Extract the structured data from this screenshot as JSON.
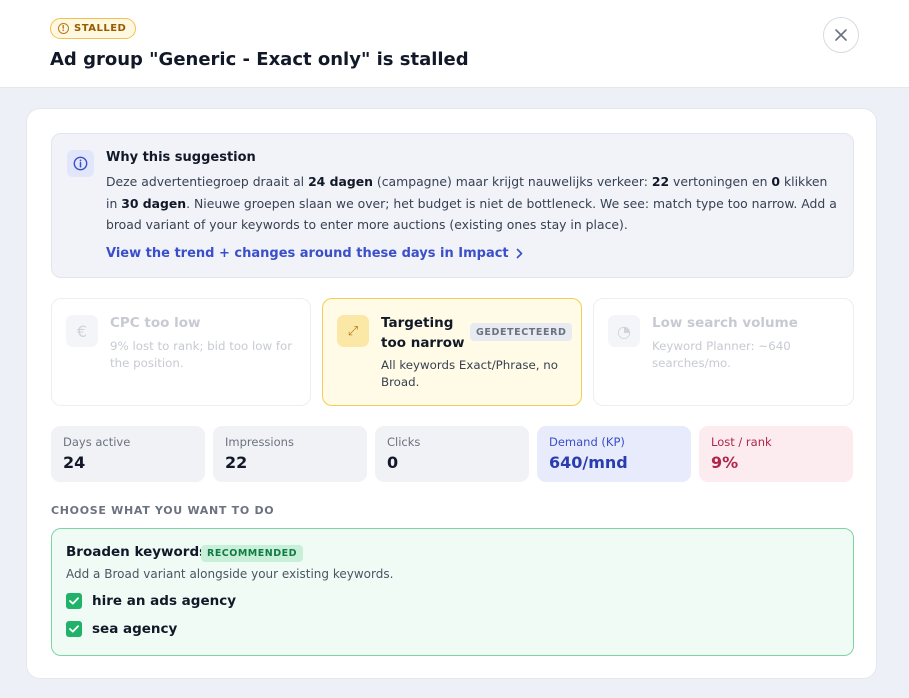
{
  "header": {
    "status_badge": "STALLED",
    "title": "Ad group \"Generic - Exact only\" is stalled"
  },
  "why": {
    "heading": "Why this suggestion",
    "t1": "Deze advertentiegroep draait al ",
    "days_campaign": "24 dagen",
    "t2": " (campagne) maar krijgt nauwelijks verkeer: ",
    "impressions": "22",
    "t3": " vertoningen en ",
    "clicks": "0",
    "t4": " klikken in ",
    "days_window": "30 dagen",
    "t5": ". Nieuwe groepen slaan we over; het budget is niet de bottleneck. We see: match type too narrow. Add a broad variant of your keywords to enter more auctions (existing ones stay in place).",
    "link": "View the trend + changes around these days in Impact"
  },
  "diagnoses": [
    {
      "title": "CPC too low",
      "desc": "9% lost to rank; bid too low for the position.",
      "icon": "euro-icon",
      "glyph": "€"
    },
    {
      "title": "Targeting too narrow",
      "badge": "GEDETECTEERD",
      "desc": "All keywords Exact/Phrase, no Broad.",
      "icon": "expand-arrows-icon",
      "glyph": "⤢"
    },
    {
      "title": "Low search volume",
      "desc": "Keyword Planner: ~640 searches/mo.",
      "icon": "pie-chart-icon",
      "glyph": "◔"
    }
  ],
  "stats": [
    {
      "label": "Days active",
      "value": "24"
    },
    {
      "label": "Impressions",
      "value": "22"
    },
    {
      "label": "Clicks",
      "value": "0"
    },
    {
      "label": "Demand (KP)",
      "value": "640/mnd"
    },
    {
      "label": "Lost / rank",
      "value": "9%"
    }
  ],
  "section_label": "CHOOSE WHAT YOU WANT TO DO",
  "option": {
    "title": "Broaden keywords",
    "badge": "RECOMMENDED",
    "desc": "Add a Broad variant alongside your existing keywords.",
    "keywords": [
      {
        "text": "hire an ads agency",
        "checked": true
      },
      {
        "text": "sea agency",
        "checked": true
      }
    ]
  },
  "colors": {
    "accent": "#3a4fc9",
    "stalled": "#f2c14e",
    "success": "#21b26a",
    "danger": "#b0264a"
  }
}
